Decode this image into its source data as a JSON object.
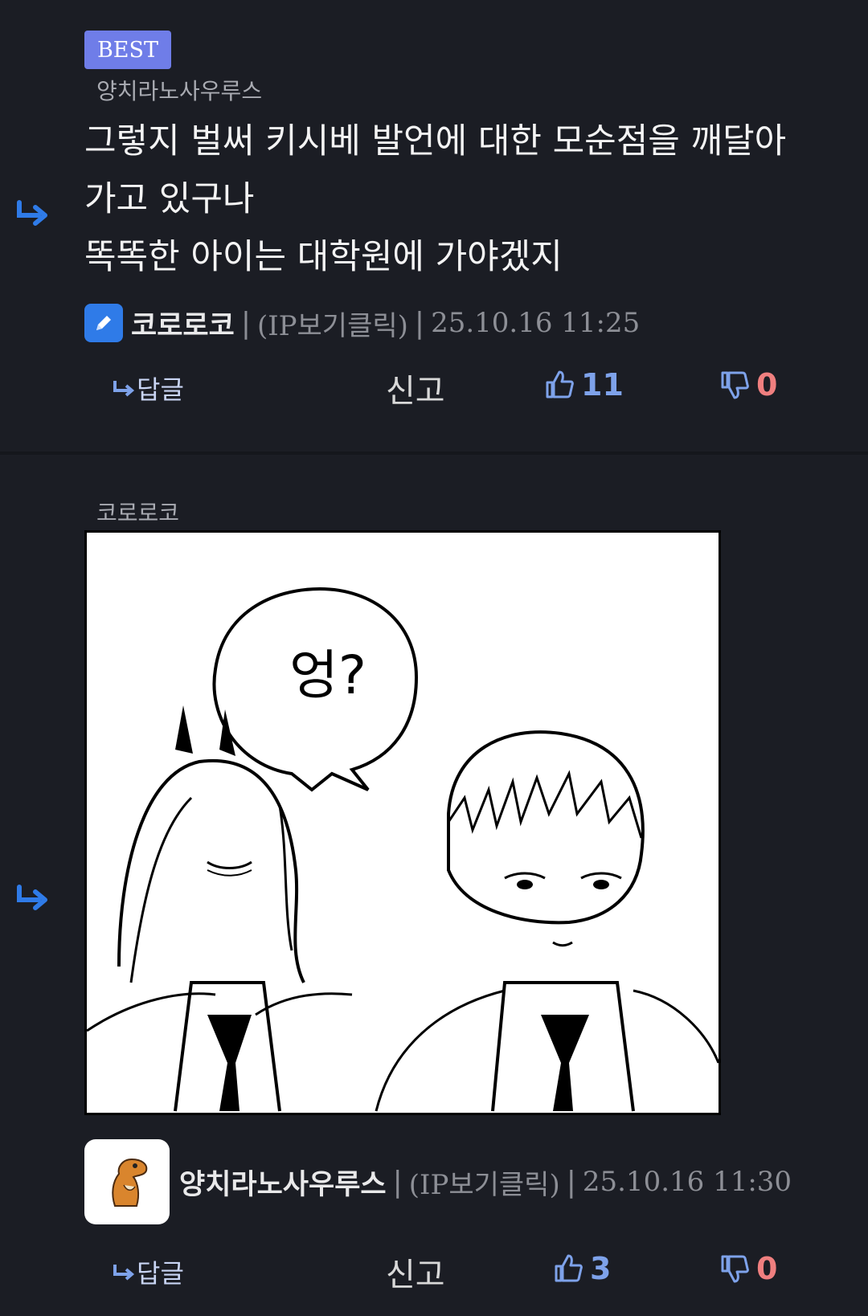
{
  "comment1": {
    "badge": "BEST",
    "parent_author": "양치라노사우루스",
    "body": "그렇지 벌써 키시베 발언에 대한 모순점을 깨달아\n가고 있구나\n똑똑한 아이는 대학원에 가야겠지",
    "author": "코로로코",
    "ip_label": "(IP보기클릭)",
    "timestamp": "25.10.16 11:25",
    "reply_label": "답글",
    "report_label": "신고",
    "upvotes": "11",
    "downvotes": "0"
  },
  "comment2": {
    "parent_author": "코로로코",
    "comic_text": "엉?",
    "author": "양치라노사우루스",
    "ip_label": "(IP보기클릭)",
    "timestamp": "25.10.16 11:30",
    "reply_label": "답글",
    "report_label": "신고",
    "upvotes": "3",
    "downvotes": "0"
  },
  "colors": {
    "accent": "#6f7de8",
    "upvote": "#7ea2ea",
    "downvote": "#ef7f7f",
    "background": "#1b1d24"
  }
}
